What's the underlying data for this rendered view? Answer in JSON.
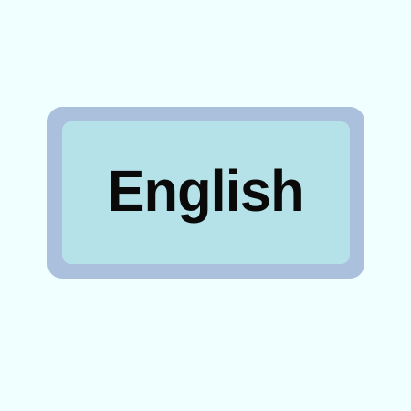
{
  "language_button": {
    "label": "English"
  },
  "colors": {
    "page_background": "#f0ffff",
    "button_border": "#aac0dc",
    "button_fill": "#b4e2e8",
    "label_text": "#0a0a0a"
  }
}
